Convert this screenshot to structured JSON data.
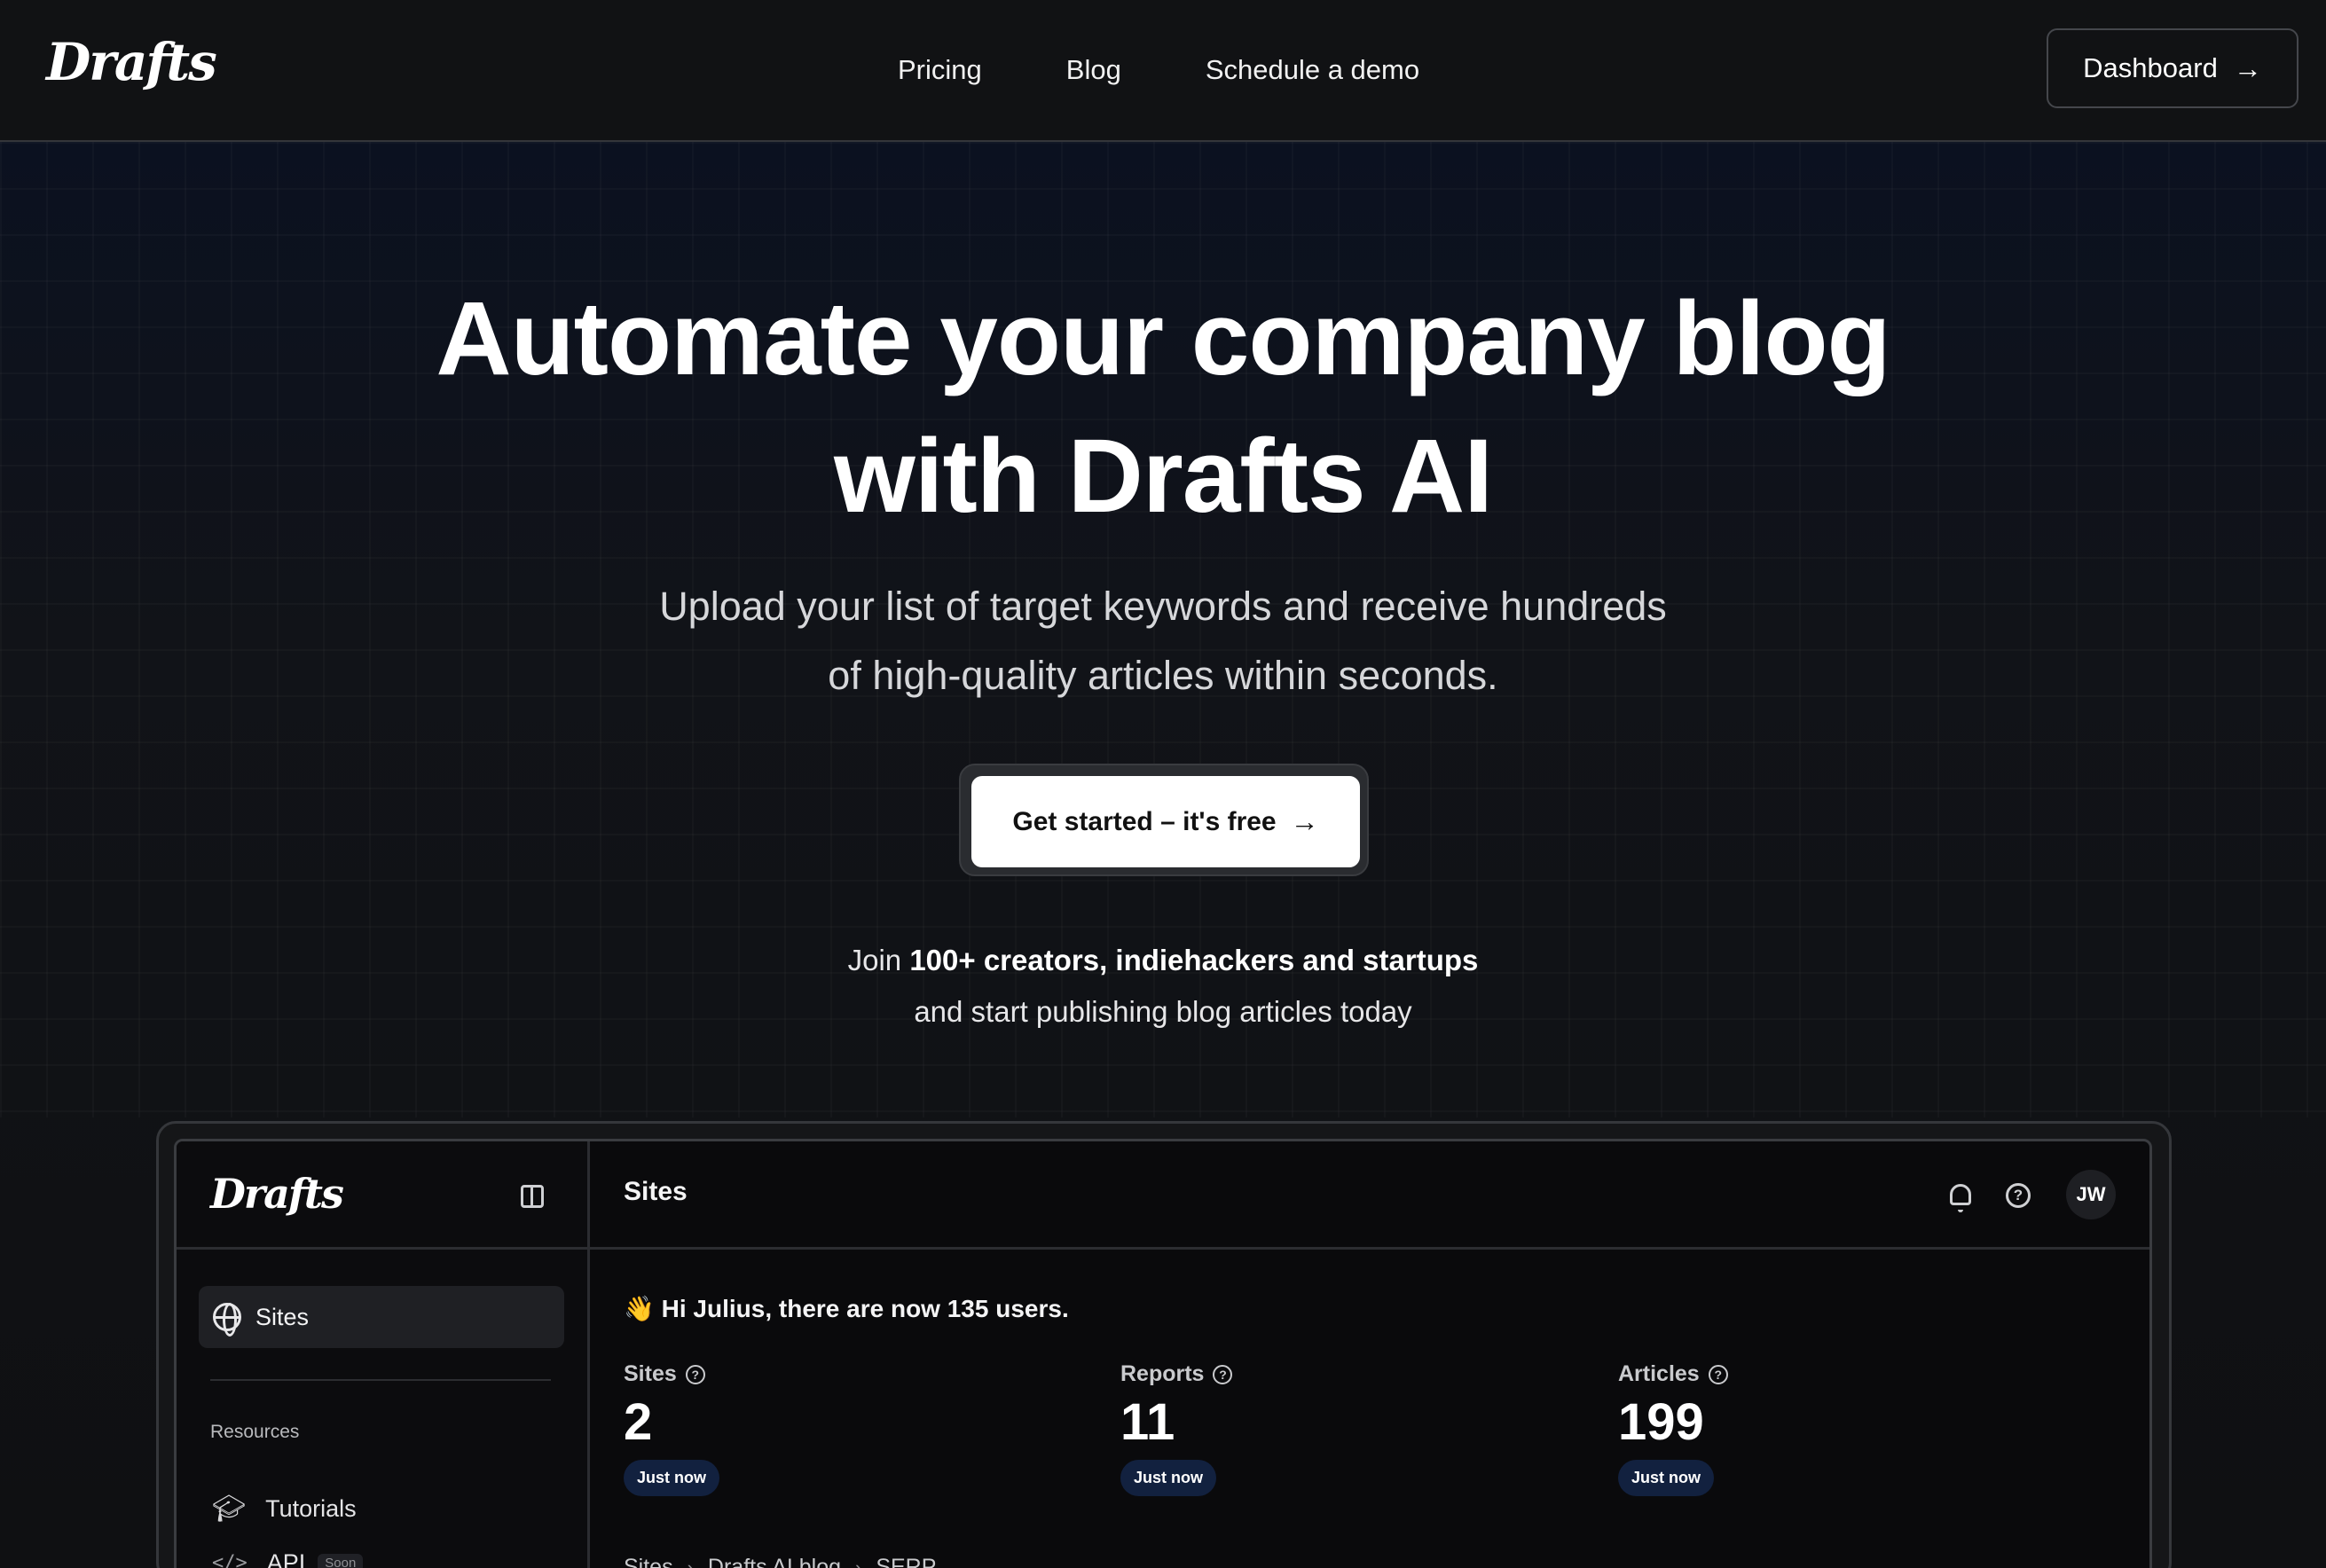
{
  "nav": {
    "logo": "Drafts",
    "links": [
      "Pricing",
      "Blog",
      "Schedule a demo"
    ],
    "dashboard_label": "Dashboard"
  },
  "hero": {
    "headline_line1": "Automate your company blog",
    "headline_line2": "with Drafts AI",
    "sub_line1": "Upload your list of target keywords and receive hundreds",
    "sub_line2": "of high-quality articles within seconds.",
    "cta_label": "Get started –  it's free",
    "join_prefix": "Join",
    "join_bold": "100+ creators, indiehackers and startups",
    "join_line2": "and start publishing blog articles today"
  },
  "preview": {
    "sidebar": {
      "logo": "Drafts",
      "active_item": "Sites",
      "section_label": "Resources",
      "items": [
        {
          "label": "Tutorials",
          "icon": "graduation-cap-icon"
        },
        {
          "label": "API",
          "icon": "code-icon",
          "badge": "Soon"
        }
      ]
    },
    "topbar": {
      "title": "Sites",
      "avatar_initials": "JW"
    },
    "greeting_emoji": "👋",
    "greeting": "Hi Julius, there are now 135 users.",
    "stats": [
      {
        "label": "Sites",
        "value": "2",
        "badge": "Just now"
      },
      {
        "label": "Reports",
        "value": "11",
        "badge": "Just now"
      },
      {
        "label": "Articles",
        "value": "199",
        "badge": "Just now"
      }
    ],
    "breadcrumb": [
      "Sites",
      "Drafts AI blog",
      "SERP"
    ]
  },
  "colors": {
    "background": "#0e0f11",
    "badge_bg": "#12213f",
    "cta_bg": "#ffffff"
  }
}
